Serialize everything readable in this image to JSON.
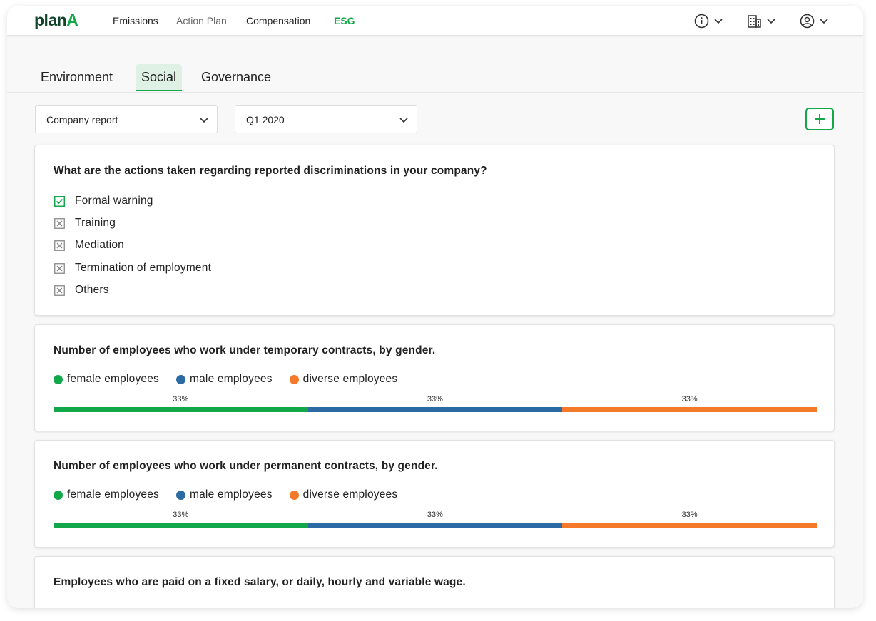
{
  "nav": {
    "logo_main": "plan",
    "logo_accent": "A",
    "items": [
      "Emissions",
      "Action Plan",
      "Compensation",
      "ESG"
    ],
    "active": "ESG",
    "icons": [
      "info-icon",
      "building-icon",
      "user-circle-icon"
    ]
  },
  "tabs": {
    "items": [
      "Environment",
      "Social",
      "Governance"
    ],
    "active": "Social"
  },
  "filters": {
    "report": "Company report",
    "period": "Q1 2020"
  },
  "colors": {
    "brand_green": "#12a84a",
    "female": "#12a84a",
    "male": "#2b6aa3",
    "diverse": "#f47a2a"
  },
  "discrimination": {
    "question": "What are the actions taken regarding reported discriminations in your company?",
    "options": [
      {
        "label": "Formal warning",
        "checked": true
      },
      {
        "label": "Training",
        "checked": false
      },
      {
        "label": "Mediation",
        "checked": false
      },
      {
        "label": "Termination of employment",
        "checked": false
      },
      {
        "label": "Others",
        "checked": false
      }
    ]
  },
  "temporary": {
    "question": "Number of employees who work under temporary contracts, by gender.",
    "legend": [
      "female employees",
      "male employees",
      "diverse employees"
    ],
    "shares": [
      33.33,
      33.33,
      33.34
    ],
    "labels": [
      "33%",
      "33%",
      "33%"
    ]
  },
  "permanent": {
    "question": "Number of employees who work under permanent contracts, by gender.",
    "legend": [
      "female employees",
      "male employees",
      "diverse employees"
    ],
    "shares": [
      33.33,
      33.33,
      33.34
    ],
    "labels": [
      "33%",
      "33%",
      "33%"
    ]
  },
  "wages": {
    "question": "Employees who are paid on a fixed salary, or daily, hourly and variable wage."
  }
}
